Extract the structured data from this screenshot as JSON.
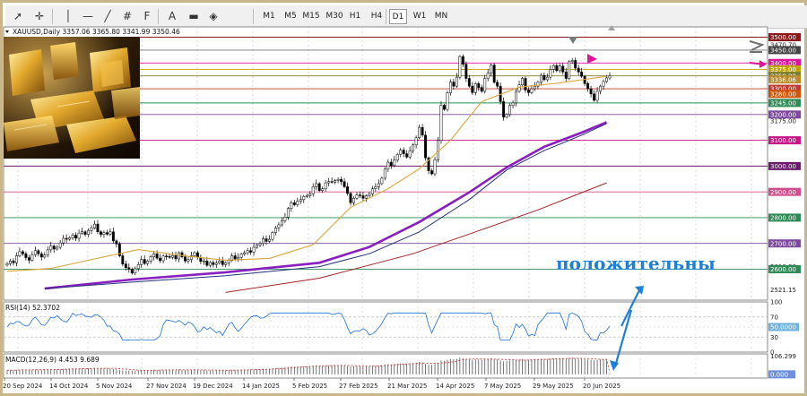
{
  "toolbar": {
    "tools": [
      {
        "name": "cursor-icon",
        "glyph": "➚"
      },
      {
        "name": "crosshair-icon",
        "glyph": "✛"
      },
      {
        "name": "vertical-line-icon",
        "glyph": "│"
      },
      {
        "name": "horizontal-line-icon",
        "glyph": "—"
      },
      {
        "name": "trendline-icon",
        "glyph": "╱"
      },
      {
        "name": "channel-icon",
        "glyph": "#"
      },
      {
        "name": "fibonacci-icon",
        "glyph": "F"
      },
      {
        "name": "text-icon",
        "glyph": "A"
      },
      {
        "name": "rectangle-icon",
        "glyph": "▬"
      },
      {
        "name": "shapes-icon",
        "glyph": "◈"
      }
    ],
    "timeframes": [
      "M1",
      "M5",
      "M15",
      "M30",
      "H1",
      "H4",
      "D1",
      "W1",
      "MN"
    ],
    "active_timeframe": "D1"
  },
  "symbol_header": "XAUUSD,Daily  3357.06 3365.80 3341.99 3350.46",
  "rsi_label": "RSI(14) 52.3702",
  "macd_label": "MACD(12,26,9) 4.453 9.689",
  "overlay_text": "положительны",
  "chart_data": {
    "type": "candlestick",
    "symbol": "XAUUSD",
    "timeframe": "Daily",
    "ohlc_last": {
      "open": 3357.06,
      "high": 3365.8,
      "low": 3341.99,
      "close": 3350.46
    },
    "ylim": [
      2480,
      3540
    ],
    "x_tick_labels": [
      "20 Sep 2024",
      "14 Oct 2024",
      "5 Nov 2024",
      "27 Nov 2024",
      "19 Dec 2024",
      "14 Jan 2025",
      "5 Feb 2025",
      "27 Feb 2025",
      "21 Mar 2025",
      "14 Apr 2025",
      "7 May 2025",
      "29 May 2025",
      "20 Jun 2025"
    ],
    "price_axis_labels": [
      {
        "price": 3500,
        "text": "3500.00",
        "style": "box",
        "color": "#8a1a1a"
      },
      {
        "price": 3470,
        "text": "3470.70",
        "style": "plain"
      },
      {
        "price": 3450,
        "text": "3450.00",
        "style": "box",
        "color": "#444444"
      },
      {
        "price": 3400,
        "text": "3400.00",
        "style": "box",
        "color": "#e0149b"
      },
      {
        "price": 3375,
        "text": "3375.00",
        "style": "box",
        "color": "#c2a400"
      },
      {
        "price": 3350,
        "text": "3350.00",
        "style": "box",
        "color": "#7d7d2f"
      },
      {
        "price": 3336,
        "text": "3336.06",
        "style": "box",
        "color": "#b98b2b"
      },
      {
        "price": 3300,
        "text": "3300.00",
        "style": "box",
        "color": "#c0392b"
      },
      {
        "price": 3280,
        "text": "3280.00",
        "style": "box",
        "color": "#d35400"
      },
      {
        "price": 3245,
        "text": "3245.00",
        "style": "box",
        "color": "#2e8b57"
      },
      {
        "price": 3200,
        "text": "3200.00",
        "style": "box",
        "color": "#7d4a9e"
      },
      {
        "price": 3175,
        "text": "3175.00",
        "style": "plain"
      },
      {
        "price": 3100,
        "text": "3100.00",
        "style": "box",
        "color": "#c71585"
      },
      {
        "price": 3000,
        "text": "3000.00",
        "style": "box",
        "color": "#6a1a6a"
      },
      {
        "price": 2900,
        "text": "2900.00",
        "style": "box",
        "color": "#d14d8c"
      },
      {
        "price": 2800,
        "text": "2800.00",
        "style": "box",
        "color": "#2e8b57"
      },
      {
        "price": 2700,
        "text": "2700.00",
        "style": "box",
        "color": "#7d4a9e"
      },
      {
        "price": 2610,
        "text": "2610.00",
        "style": "plain"
      },
      {
        "price": 2600,
        "text": "2600.00",
        "style": "box",
        "color": "#2e8b57"
      },
      {
        "price": 2521.15,
        "text": "2521.15",
        "style": "plain"
      }
    ],
    "horizontal_levels": [
      {
        "price": 3500,
        "color": "#8a1a1a"
      },
      {
        "price": 3450,
        "color": "#777777"
      },
      {
        "price": 3400,
        "color": "#e0149b"
      },
      {
        "price": 3375,
        "color": "#c2a400"
      },
      {
        "price": 3350,
        "color": "#7d7d2f"
      },
      {
        "price": 3300,
        "color": "#c0392b"
      },
      {
        "price": 3245,
        "color": "#2e8b57"
      },
      {
        "price": 3200,
        "color": "#7d4a9e"
      },
      {
        "price": 3100,
        "color": "#c71585"
      },
      {
        "price": 3000,
        "color": "#6a1a6a"
      },
      {
        "price": 2900,
        "color": "#d14d8c"
      },
      {
        "price": 2800,
        "color": "#2e8b57"
      },
      {
        "price": 2700,
        "color": "#7d4a9e"
      },
      {
        "price": 2600,
        "color": "#2e8b57"
      }
    ],
    "closes": [
      2622,
      2632,
      2625,
      2652,
      2668,
      2660,
      2645,
      2635,
      2656,
      2672,
      2660,
      2647,
      2655,
      2675,
      2690,
      2678,
      2685,
      2702,
      2720,
      2716,
      2722,
      2732,
      2720,
      2740,
      2745,
      2735,
      2750,
      2760,
      2775,
      2745,
      2735,
      2742,
      2736,
      2745,
      2710,
      2698,
      2652,
      2620,
      2606,
      2600,
      2585,
      2602,
      2618,
      2638,
      2622,
      2632,
      2648,
      2660,
      2643,
      2633,
      2651,
      2650,
      2646,
      2653,
      2640,
      2664,
      2648,
      2632,
      2638,
      2652,
      2664,
      2646,
      2630,
      2632,
      2615,
      2626,
      2618,
      2624,
      2632,
      2618,
      2625,
      2634,
      2652,
      2640,
      2646,
      2658,
      2664,
      2672,
      2666,
      2685,
      2694,
      2700,
      2718,
      2708,
      2716,
      2742,
      2760,
      2772,
      2788,
      2802,
      2836,
      2858,
      2850,
      2864,
      2870,
      2882,
      2885,
      2892,
      2920,
      2932,
      2905,
      2912,
      2935,
      2940,
      2938,
      2944,
      2948,
      2940,
      2920,
      2894,
      2858,
      2875,
      2888,
      2885,
      2875,
      2885,
      2892,
      2912,
      2920,
      2932,
      2953,
      2988,
      3015,
      3002,
      3023,
      3045,
      3062,
      3048,
      3035,
      3060,
      3082,
      3110,
      3150,
      3120,
      3032,
      2982,
      2970,
      3025,
      3100,
      3236,
      3220,
      3284,
      3326,
      3310,
      3345,
      3425,
      3395,
      3340,
      3310,
      3285,
      3320,
      3305,
      3290,
      3340,
      3360,
      3392,
      3325,
      3310,
      3250,
      3190,
      3200,
      3235,
      3245,
      3290,
      3315,
      3340,
      3295,
      3285,
      3300,
      3310,
      3325,
      3352,
      3335,
      3345,
      3375,
      3390,
      3370,
      3388,
      3365,
      3340,
      3405,
      3410,
      3380,
      3365,
      3348,
      3320,
      3300,
      3280,
      3255,
      3290,
      3310,
      3328,
      3342,
      3350
    ],
    "ma_series": [
      {
        "name": "MA-short",
        "color": "#d8a53c",
        "width": 1.1,
        "points": [
          [
            0,
            2592
          ],
          [
            14,
            2603
          ],
          [
            28,
            2640
          ],
          [
            42,
            2676
          ],
          [
            58,
            2650
          ],
          [
            70,
            2635
          ],
          [
            84,
            2642
          ],
          [
            98,
            2695
          ],
          [
            110,
            2840
          ],
          [
            122,
            2912
          ],
          [
            132,
            2990
          ],
          [
            142,
            3100
          ],
          [
            152,
            3250
          ],
          [
            164,
            3306
          ],
          [
            176,
            3321
          ],
          [
            192,
            3348
          ]
        ]
      },
      {
        "name": "MA-mid-purple",
        "color": "#8a1fbf",
        "width": 2.6,
        "points": [
          [
            12,
            2525
          ],
          [
            40,
            2560
          ],
          [
            70,
            2588
          ],
          [
            100,
            2625
          ],
          [
            116,
            2686
          ],
          [
            132,
            2783
          ],
          [
            148,
            2898
          ],
          [
            160,
            2995
          ],
          [
            172,
            3075
          ],
          [
            184,
            3130
          ],
          [
            192,
            3170
          ]
        ]
      },
      {
        "name": "MA-mid-navy",
        "color": "#22327a",
        "width": 1.0,
        "points": [
          [
            12,
            2525
          ],
          [
            40,
            2550
          ],
          [
            70,
            2575
          ],
          [
            100,
            2610
          ],
          [
            116,
            2660
          ],
          [
            132,
            2745
          ],
          [
            148,
            2870
          ],
          [
            160,
            2985
          ],
          [
            172,
            3060
          ],
          [
            184,
            3120
          ],
          [
            192,
            3165
          ]
        ]
      },
      {
        "name": "MA-long-red",
        "color": "#a32626",
        "width": 1.0,
        "points": [
          [
            70,
            2510
          ],
          [
            100,
            2565
          ],
          [
            130,
            2660
          ],
          [
            150,
            2745
          ],
          [
            170,
            2830
          ],
          [
            192,
            2935
          ]
        ]
      }
    ],
    "rsi": {
      "ylim": [
        0,
        100
      ],
      "levels": [
        70,
        50,
        30
      ],
      "tick_labels": [
        "100",
        "70",
        "50",
        "30",
        "0"
      ],
      "current": 52.3702,
      "marker_label": "50.0000"
    },
    "macd": {
      "ylim": [
        -20,
        110
      ],
      "current_main": 4.453,
      "current_signal": 9.689,
      "tick_labels": [
        "106.299",
        "0.000"
      ]
    }
  }
}
